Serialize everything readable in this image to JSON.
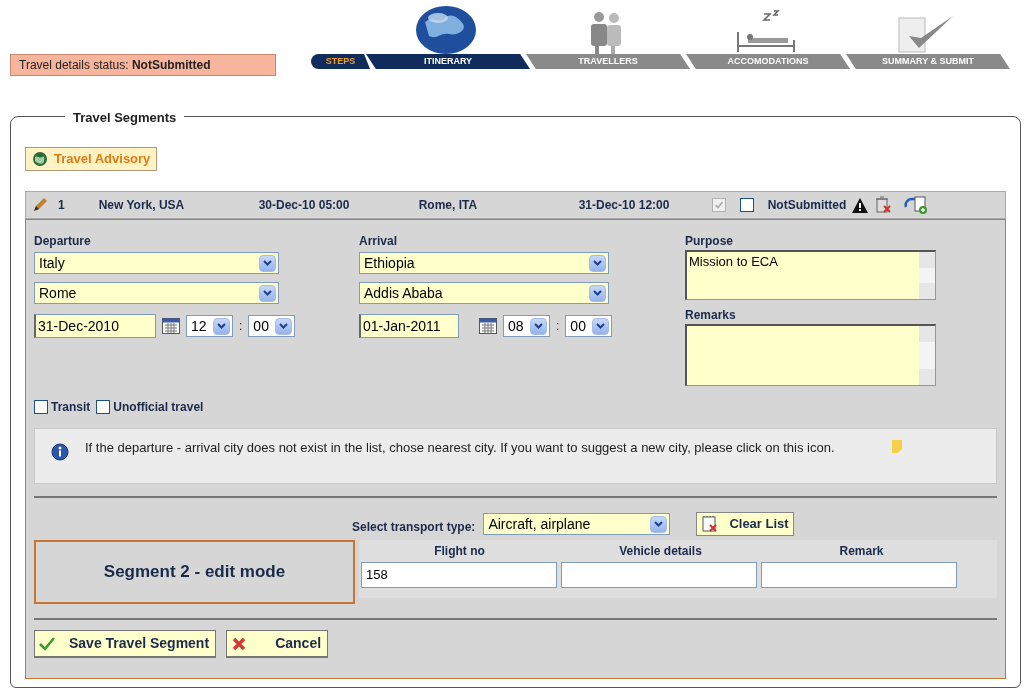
{
  "status": {
    "label": "Travel details status:",
    "value": "NotSubmitted"
  },
  "steps": {
    "label": "STEPS",
    "items": [
      {
        "label": "ITINERARY",
        "selected": true
      },
      {
        "label": "TRAVELLERS",
        "selected": false
      },
      {
        "label": "ACCOMODATIONS",
        "selected": false
      },
      {
        "label": "SUMMARY & SUBMIT",
        "selected": false
      }
    ]
  },
  "legend": "Travel Segments",
  "advisory_button": "Travel Advisory",
  "segment_header": {
    "number": "1",
    "from": "New York, USA",
    "departure": "30-Dec-10 05:00",
    "to": "Rome, ITA",
    "arrival": "31-Dec-10 12:00",
    "confirmed": {
      "checked": true,
      "disabled": true
    },
    "submitted": {
      "checked": false,
      "disabled": false
    },
    "status": "NotSubmitted"
  },
  "departure": {
    "label": "Departure",
    "country": "Italy",
    "city": "Rome",
    "date": "31-Dec-2010",
    "hour": "12",
    "separator": ":",
    "minute": "00"
  },
  "arrival": {
    "label": "Arrival",
    "country": "Ethiopia",
    "city": "Addis Ababa",
    "date": "01-Jan-2011",
    "hour": "08",
    "separator": ":",
    "minute": "00"
  },
  "purpose": {
    "label": "Purpose",
    "value": "Mission to ECA"
  },
  "remarks": {
    "label": "Remarks"
  },
  "options": [
    {
      "label": "Transit",
      "checked": false
    },
    {
      "label": "Unofficial travel",
      "checked": false
    }
  ],
  "info": "If the departure - arrival city does not exist in the list, chose nearest city. If you want to suggest a new city, please click on this icon.",
  "transport": {
    "label": "Select transport type:",
    "value": "Aircraft, airplane"
  },
  "clear_button": "Clear List",
  "segment_mode": "Segment 2 - edit mode",
  "vehicle_table": {
    "columns": [
      "Flight no",
      "Vehicle details",
      "Remark"
    ],
    "values": [
      "158"
    ]
  },
  "buttons": [
    {
      "label": "Save Travel Segment",
      "kind": "save"
    },
    {
      "label": "Cancel",
      "kind": "cancel"
    }
  ]
}
